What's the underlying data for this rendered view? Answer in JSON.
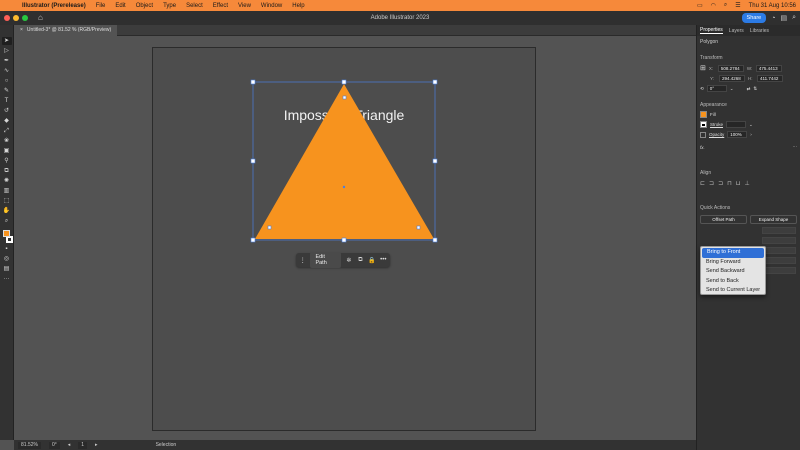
{
  "menubar": {
    "app_name": "Illustrator (Prerelease)",
    "items": [
      "File",
      "Edit",
      "Object",
      "Type",
      "Select",
      "Effect",
      "View",
      "Window",
      "Help"
    ],
    "datetime": "Thu 31 Aug 10:56"
  },
  "window": {
    "title": "Adobe Illustrator 2023",
    "share_label": "Share"
  },
  "document": {
    "tab_label": "Untitled-3* @ 81.52 % (RGB/Preview)"
  },
  "artwork": {
    "text": "Impossible Triangle",
    "fill_color": "#f7931e",
    "selection_color": "#4a7fe0"
  },
  "taskbar": {
    "edit_path_label": "Edit Path",
    "more_label": "•••"
  },
  "panel": {
    "tabs": [
      "Properties",
      "Layers",
      "Libraries"
    ],
    "object_type": "Polygon",
    "transform": {
      "title": "Transform",
      "x_label": "X:",
      "x_value": "508.2784",
      "y_label": "Y:",
      "y_value": "294.4268",
      "w_label": "W:",
      "w_value": "475.4413",
      "h_label": "H:",
      "h_value": "411.7442",
      "angle_value": "0°"
    },
    "appearance": {
      "title": "Appearance",
      "fill_label": "Fill",
      "stroke_label": "Stroke",
      "opacity_label": "Opacity",
      "opacity_value": "100%",
      "fx_label": "fx."
    },
    "align_title": "Align",
    "quick_actions": {
      "title": "Quick Actions",
      "offset_label": "Offset Path",
      "expand_label": "Expand Shape"
    }
  },
  "dropdown": {
    "items": [
      "Bring to Front",
      "Bring Forward",
      "Send Backward",
      "Send to Back",
      "Send to Current Layer"
    ]
  },
  "statusbar": {
    "zoom": "81.52%",
    "rotation": "0°",
    "artboard": "1",
    "tool": "Selection"
  }
}
